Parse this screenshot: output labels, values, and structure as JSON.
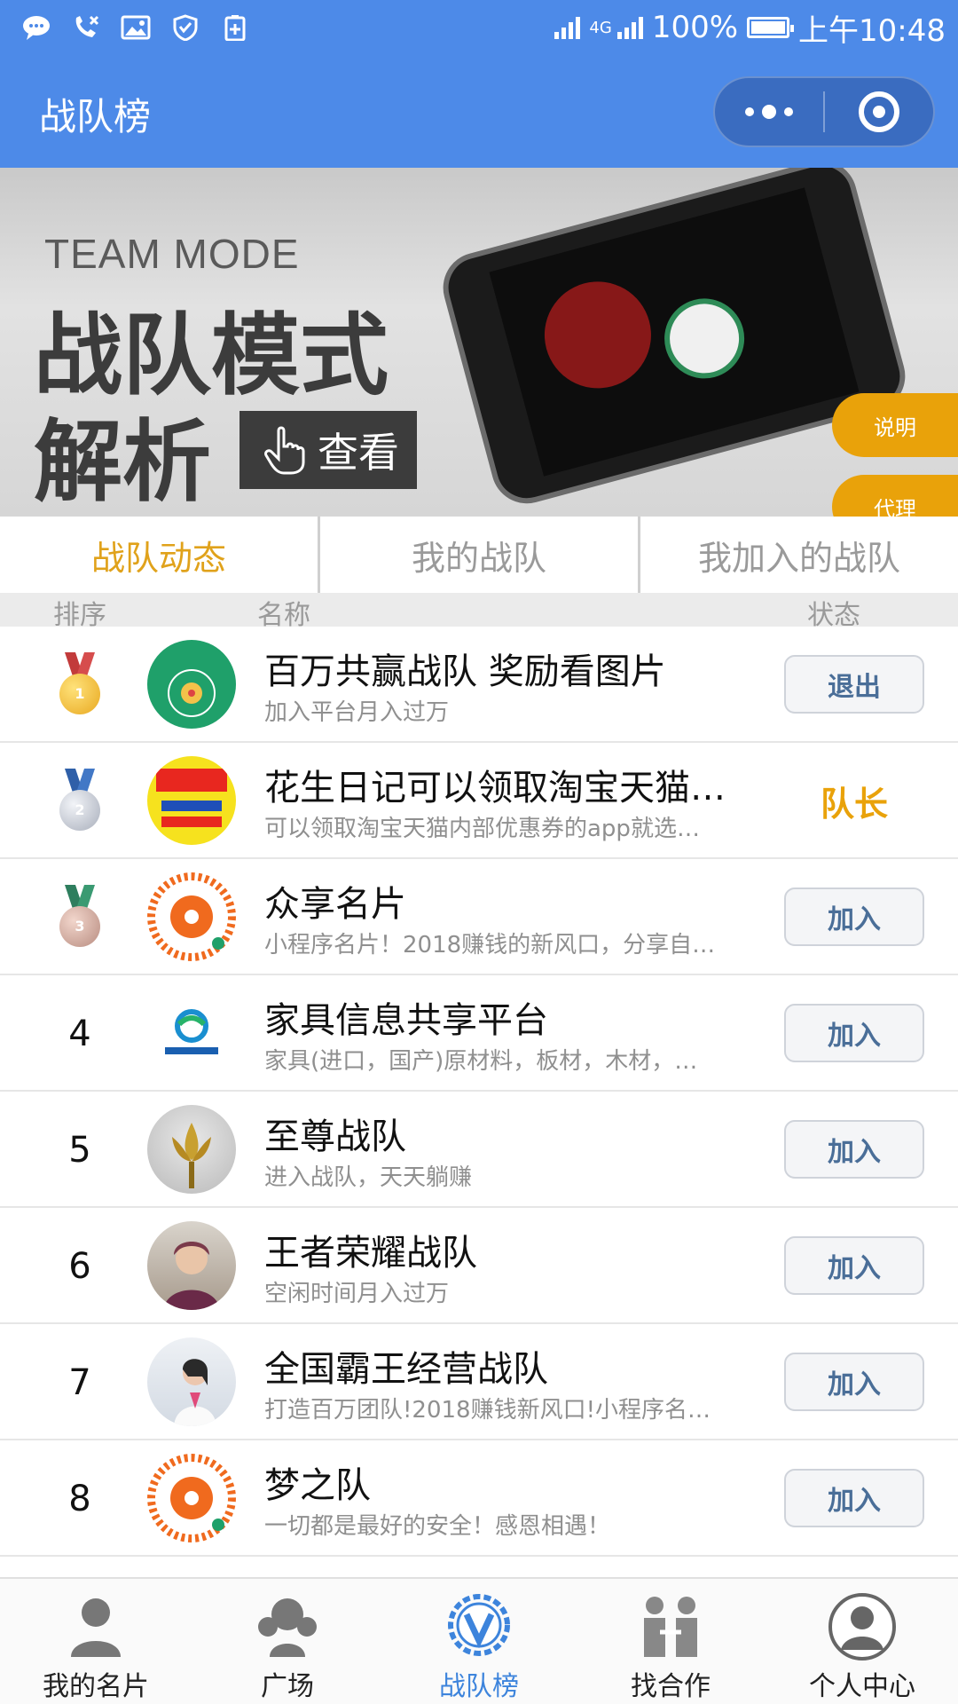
{
  "status_bar": {
    "battery": "100%",
    "time": "上午10:48",
    "network": "4G"
  },
  "header": {
    "title": "战队榜"
  },
  "banner": {
    "en": "TEAM MODE",
    "line1": "战队模式",
    "line2": "解析",
    "view": "查看",
    "explain": "说明",
    "agent": "代理",
    "slides": 3,
    "active_slide": 1
  },
  "tabs": [
    {
      "label": "战队动态",
      "active": true
    },
    {
      "label": "我的战队",
      "active": false
    },
    {
      "label": "我加入的战队",
      "active": false
    }
  ],
  "columns": {
    "rank": "排序",
    "name": "名称",
    "status": "状态"
  },
  "teams": [
    {
      "rank": "1",
      "medal": "gold-medal",
      "title": "百万共赢战队 奖励看图片",
      "desc": "加入平台月入过万",
      "action": "退出",
      "leader": false
    },
    {
      "rank": "2",
      "medal": "silver-medal",
      "title": "花生日记可以领取淘宝天猫…",
      "desc": "可以领取淘宝天猫内部优惠券的app就选…",
      "action": "队长",
      "leader": true
    },
    {
      "rank": "3",
      "medal": "bronze-medal",
      "title": "众享名片",
      "desc": "小程序名片！2018赚钱的新风口，分享自…",
      "action": "加入",
      "leader": false
    },
    {
      "rank": "4",
      "medal": "",
      "title": "家具信息共享平台",
      "desc": "家具(进口，国产)原材料，板材，木材，…",
      "action": "加入",
      "leader": false
    },
    {
      "rank": "5",
      "medal": "",
      "title": "至尊战队",
      "desc": "进入战队，天天躺赚",
      "action": "加入",
      "leader": false
    },
    {
      "rank": "6",
      "medal": "",
      "title": "王者荣耀战队",
      "desc": "空闲时间月入过万",
      "action": "加入",
      "leader": false
    },
    {
      "rank": "7",
      "medal": "",
      "title": "全国霸王经营战队",
      "desc": "打造百万团队!2018赚钱新风口!小程序名…",
      "action": "加入",
      "leader": false
    },
    {
      "rank": "8",
      "medal": "",
      "title": "梦之队",
      "desc": "一切都是最好的安全！感恩相遇！",
      "action": "加入",
      "leader": false
    }
  ],
  "bottom_nav": [
    {
      "label": "我的名片",
      "icon": "person-card-icon",
      "active": false
    },
    {
      "label": "广场",
      "icon": "group-icon",
      "active": false
    },
    {
      "label": "战队榜",
      "icon": "v-badge-icon",
      "active": true
    },
    {
      "label": "找合作",
      "icon": "handshake-icon",
      "active": false
    },
    {
      "label": "个人中心",
      "icon": "user-circle-icon",
      "active": false
    }
  ],
  "colors": {
    "header": "#4d8ae8",
    "accent": "#e9a20a",
    "tab_active": "#e0a21b",
    "nav_active": "#3d84dc"
  }
}
